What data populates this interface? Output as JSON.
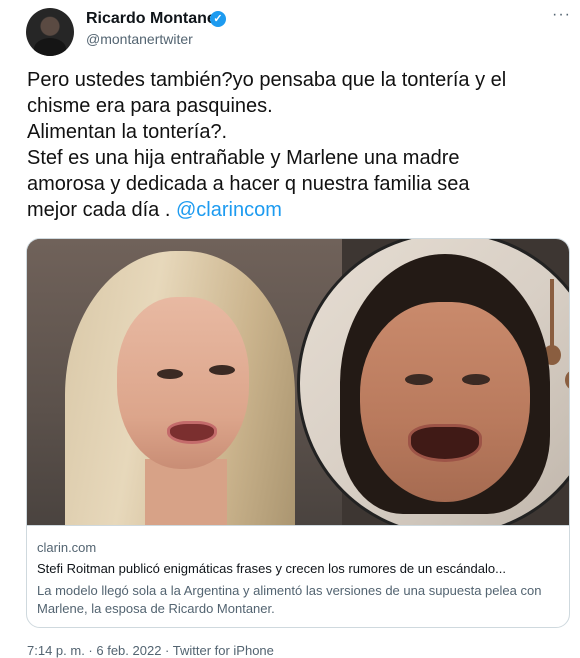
{
  "author": {
    "display_name": "Ricardo Montaner",
    "handle": "@montanertwiter",
    "verified_icon": "verified-badge-icon"
  },
  "more_label": "···",
  "tweet": {
    "lines": [
      "Pero ustedes también?yo pensaba que la tontería y el",
      "chisme era para pasquines.",
      "Alimentan la tontería?.",
      "Stef es una hija entrañable y Marlene una madre",
      "amorosa y dedicada a hacer q nuestra familia sea"
    ],
    "last_line_text": "mejor cada día . ",
    "mention": "@clarincom"
  },
  "card": {
    "domain": "clarin.com",
    "title": "Stefi Roitman publicó enigmáticas frases y crecen los rumores de un escándalo...",
    "description": "La modelo llegó sola a la Argentina y alimentó las versiones de una supuesta pelea con Marlene, la esposa de Ricardo Montaner."
  },
  "meta": {
    "timestamp": "7:14 p. m. · 6 feb. 2022 · Twitter for iPhone"
  },
  "colors": {
    "link": "#1d9bf0",
    "secondary_text": "#536471",
    "border": "#cfd9de"
  }
}
